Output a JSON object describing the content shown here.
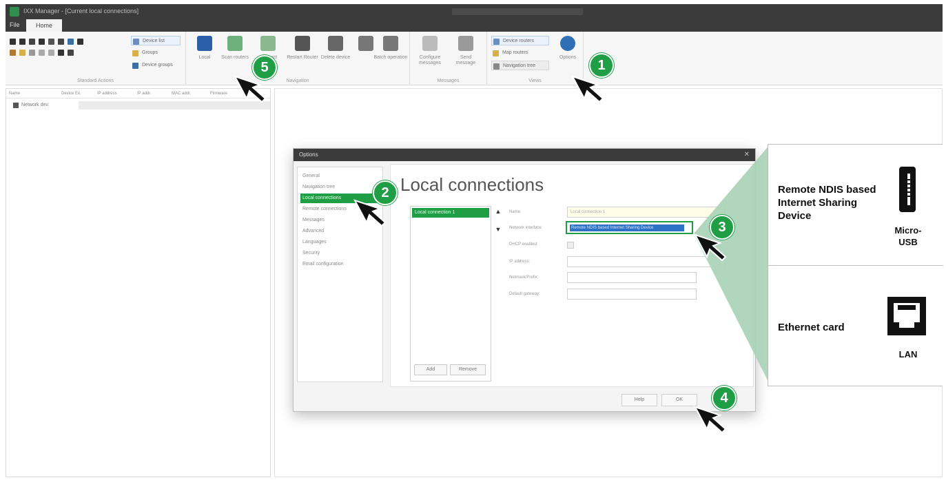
{
  "window": {
    "title": "IXX Manager - [Current local connections]",
    "file_tab": "File",
    "home_tab": "Home"
  },
  "ribbon": {
    "groups": [
      {
        "name": "Standard Actions"
      },
      {
        "name": "Navigation"
      },
      {
        "name": "Messages"
      },
      {
        "name": "Views"
      }
    ],
    "group1_rows": [
      "Device list",
      "Groups",
      "Device groups"
    ],
    "buttons": {
      "local": "Local",
      "scan_routers": "Scan routers",
      "connect": "Connect Routers",
      "restart": "Restart Router",
      "delete": "Delete device",
      "batch_operation": "Batch operation",
      "configure_messages": "Configure messages",
      "send_message": "Send message",
      "options": "Options"
    },
    "view_rows": [
      "Device routers",
      "Map routers",
      "Navigation tree"
    ]
  },
  "left_panel": {
    "columns": [
      "Name",
      "Device Ex.",
      "IP address",
      "IP addr.",
      "MAC addr.",
      "Firmware"
    ],
    "tree_root": "Network dev."
  },
  "options_dialog": {
    "title": "Options",
    "nav_items": [
      "General",
      "Navigation tree",
      "Local connections",
      "Remote connections",
      "Messages",
      "Advanced",
      "Languages",
      "Security",
      "Email configuration"
    ],
    "selected_nav": "Local connections",
    "heading": "Local connections",
    "connections": [
      "Local connection 1"
    ],
    "add_label": "Add",
    "remove_label": "Remove",
    "fields": {
      "name_label": "Name:",
      "name_value": "Local connection 1",
      "network_interface_label": "Network interface:",
      "network_interface_value": "Remote NDIS based Internet Sharing Device",
      "dhcp_label": "DHCP enabled:",
      "ip_label": "IP address:",
      "netmask_label": "Netmask/Prefix:",
      "gateway_label": "Default gateway:"
    },
    "help_label": "Help",
    "ok_label": "OK"
  },
  "info_panel": {
    "usb_label": "Remote NDIS based Internet Sharing Device",
    "usb_caption": "Micro-USB",
    "lan_label": "Ethernet card",
    "lan_caption": "LAN"
  },
  "steps": [
    "1",
    "2",
    "3",
    "4",
    "5"
  ],
  "colors": {
    "accent_green": "#1f9e46",
    "callout_green": "#a7d3b7",
    "titlebar": "#3b3b3b",
    "selection_blue": "#2d72c4"
  }
}
